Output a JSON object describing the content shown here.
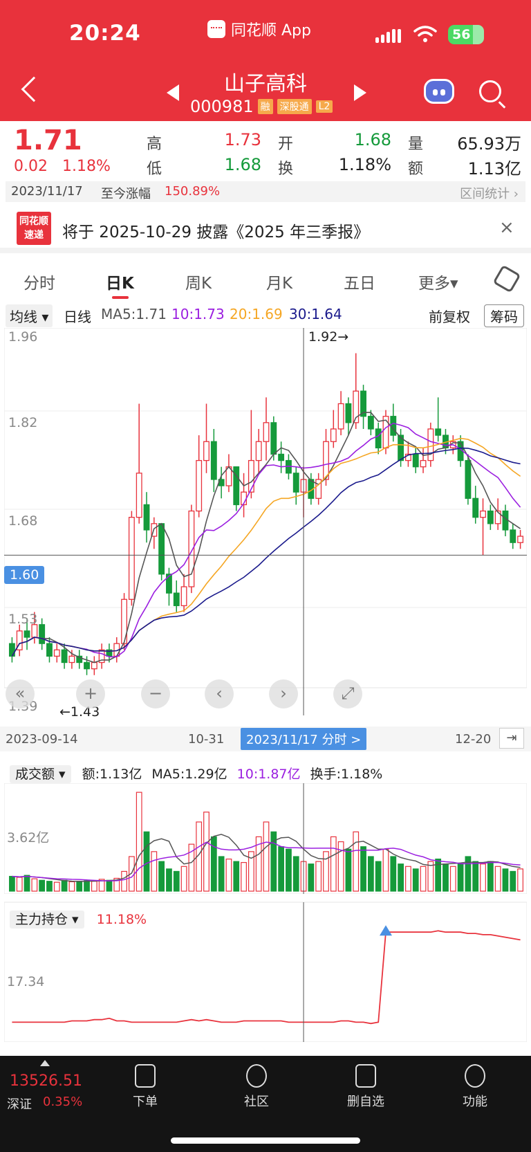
{
  "status_bar": {
    "time": "20:24",
    "app_label": "同花顺 App",
    "battery": "56"
  },
  "header": {
    "stock_name": "山子高科",
    "stock_code": "000981",
    "tags": [
      "融",
      "深股通",
      "L2"
    ]
  },
  "quote": {
    "price": "1.71",
    "change": "0.02",
    "change_pct": "1.18%",
    "high_label": "高",
    "high": "1.73",
    "low_label": "低",
    "low": "1.68",
    "open_label": "开",
    "open": "1.68",
    "turnover_label": "换",
    "turnover": "1.18%",
    "volume_label": "量",
    "volume": "65.93万",
    "amount_label": "额",
    "amount": "1.13亿",
    "colors": {
      "up": "#e8323c",
      "down": "#159a3b"
    }
  },
  "date_bar": {
    "date": "2023/11/17",
    "label": "至今涨幅",
    "value": "150.89%",
    "stat": "区间统计"
  },
  "notice": {
    "logo_line1": "同花顺",
    "logo_line2": "速递",
    "text": "将于 2025-10-29 披露《2025 年三季报》",
    "close": "×"
  },
  "tabs": [
    "分时",
    "日K",
    "周K",
    "月K",
    "五日",
    "更多▾"
  ],
  "ma_bar": {
    "selector": "均线",
    "period": "日线",
    "ma5": "MA5:1.71",
    "ma10": "10:1.73",
    "ma20": "20:1.69",
    "ma30": "30:1.64",
    "fq": "前复权",
    "chips": "筹码"
  },
  "kline": {
    "y_labels": [
      "1.96",
      "1.82",
      "1.68",
      "1.53",
      "1.39"
    ],
    "cursor_price": "1.60",
    "high_mark": "1.92→",
    "low_mark": "←1.43",
    "date_start": "2023-09-14",
    "date_mid": "10-31",
    "date_pill": "2023/11/17 分时 >",
    "date_end": "12-20"
  },
  "volume_panel": {
    "selector": "成交额",
    "amt": "额:1.13亿",
    "ma5": "MA5:1.29亿",
    "ma10": "10:1.87亿",
    "turnover": "换手:1.18%",
    "y_label": "3.62亿"
  },
  "holding_panel": {
    "selector": "主力持仓",
    "value": "11.18%",
    "y_label": "17.34"
  },
  "bottom_nav": {
    "index_value": "13526.51",
    "index_name": "深证",
    "index_pct": "0.35%",
    "items": [
      "下单",
      "社区",
      "删自选",
      "功能"
    ]
  },
  "chart_data": {
    "type": "candlestick",
    "ylim": [
      1.39,
      1.96
    ],
    "candles": [
      [
        1.46,
        1.44,
        1.47,
        1.43
      ],
      [
        1.45,
        1.48,
        1.49,
        1.44
      ],
      [
        1.48,
        1.47,
        1.5,
        1.45
      ],
      [
        1.47,
        1.49,
        1.51,
        1.46
      ],
      [
        1.49,
        1.46,
        1.5,
        1.45
      ],
      [
        1.46,
        1.44,
        1.47,
        1.43
      ],
      [
        1.44,
        1.45,
        1.46,
        1.43
      ],
      [
        1.45,
        1.43,
        1.46,
        1.42
      ],
      [
        1.43,
        1.44,
        1.45,
        1.42
      ],
      [
        1.44,
        1.43,
        1.45,
        1.42
      ],
      [
        1.43,
        1.42,
        1.44,
        1.41
      ],
      [
        1.42,
        1.43,
        1.44,
        1.41
      ],
      [
        1.43,
        1.45,
        1.46,
        1.42
      ],
      [
        1.45,
        1.44,
        1.46,
        1.43
      ],
      [
        1.44,
        1.46,
        1.47,
        1.43
      ],
      [
        1.46,
        1.53,
        1.54,
        1.45
      ],
      [
        1.53,
        1.66,
        1.67,
        1.52
      ],
      [
        1.66,
        1.73,
        1.84,
        1.65
      ],
      [
        1.68,
        1.64,
        1.7,
        1.62
      ],
      [
        1.63,
        1.65,
        1.66,
        1.61
      ],
      [
        1.65,
        1.57,
        1.65,
        1.56
      ],
      [
        1.57,
        1.54,
        1.58,
        1.52
      ],
      [
        1.54,
        1.52,
        1.56,
        1.51
      ],
      [
        1.52,
        1.55,
        1.57,
        1.51
      ],
      [
        1.55,
        1.67,
        1.68,
        1.54
      ],
      [
        1.67,
        1.75,
        1.79,
        1.66
      ],
      [
        1.75,
        1.78,
        1.84,
        1.73
      ],
      [
        1.78,
        1.72,
        1.8,
        1.7
      ],
      [
        1.72,
        1.71,
        1.74,
        1.69
      ],
      [
        1.71,
        1.74,
        1.76,
        1.7
      ],
      [
        1.74,
        1.68,
        1.74,
        1.67
      ],
      [
        1.68,
        1.7,
        1.73,
        1.66
      ],
      [
        1.7,
        1.75,
        1.83,
        1.69
      ],
      [
        1.75,
        1.78,
        1.8,
        1.73
      ],
      [
        1.78,
        1.81,
        1.85,
        1.75
      ],
      [
        1.81,
        1.76,
        1.82,
        1.75
      ],
      [
        1.76,
        1.75,
        1.78,
        1.73
      ],
      [
        1.75,
        1.73,
        1.76,
        1.72
      ],
      [
        1.73,
        1.7,
        1.74,
        1.68
      ],
      [
        1.7,
        1.72,
        1.74,
        1.66
      ],
      [
        1.72,
        1.69,
        1.73,
        1.68
      ],
      [
        1.69,
        1.72,
        1.73,
        1.68
      ],
      [
        1.72,
        1.78,
        1.8,
        1.71
      ],
      [
        1.78,
        1.8,
        1.83,
        1.77
      ],
      [
        1.8,
        1.84,
        1.86,
        1.79
      ],
      [
        1.84,
        1.81,
        1.85,
        1.79
      ],
      [
        1.81,
        1.86,
        1.92,
        1.8
      ],
      [
        1.86,
        1.82,
        1.87,
        1.8
      ],
      [
        1.82,
        1.8,
        1.83,
        1.79
      ],
      [
        1.8,
        1.77,
        1.81,
        1.76
      ],
      [
        1.77,
        1.82,
        1.83,
        1.76
      ],
      [
        1.82,
        1.79,
        1.84,
        1.78
      ],
      [
        1.79,
        1.75,
        1.8,
        1.74
      ],
      [
        1.75,
        1.76,
        1.78,
        1.74
      ],
      [
        1.76,
        1.74,
        1.77,
        1.73
      ],
      [
        1.74,
        1.75,
        1.77,
        1.73
      ],
      [
        1.75,
        1.8,
        1.81,
        1.74
      ],
      [
        1.8,
        1.79,
        1.85,
        1.78
      ],
      [
        1.79,
        1.77,
        1.8,
        1.76
      ],
      [
        1.77,
        1.78,
        1.79,
        1.76
      ],
      [
        1.78,
        1.75,
        1.79,
        1.74
      ],
      [
        1.75,
        1.69,
        1.76,
        1.68
      ],
      [
        1.69,
        1.66,
        1.71,
        1.65
      ],
      [
        1.66,
        1.67,
        1.69,
        1.6
      ],
      [
        1.67,
        1.65,
        1.68,
        1.64
      ],
      [
        1.65,
        1.67,
        1.69,
        1.64
      ],
      [
        1.67,
        1.64,
        1.68,
        1.63
      ],
      [
        1.64,
        1.62,
        1.65,
        1.61
      ],
      [
        1.62,
        1.63,
        1.64,
        1.61
      ]
    ],
    "ma5_color": "#555555",
    "ma10_color": "#9b1fe0",
    "ma20_color": "#f5a623",
    "ma30_color": "#1a1a8c",
    "volume": [
      30,
      28,
      32,
      25,
      22,
      20,
      18,
      22,
      19,
      20,
      21,
      20,
      24,
      22,
      26,
      40,
      70,
      200,
      120,
      80,
      60,
      45,
      40,
      50,
      95,
      140,
      160,
      110,
      70,
      65,
      60,
      58,
      80,
      110,
      140,
      120,
      90,
      85,
      70,
      60,
      55,
      60,
      80,
      110,
      100,
      85,
      120,
      90,
      70,
      60,
      85,
      70,
      55,
      50,
      45,
      50,
      60,
      65,
      55,
      50,
      55,
      70,
      60,
      55,
      60,
      50,
      45,
      40,
      45
    ],
    "holding": [
      10,
      10,
      10,
      10,
      10,
      10,
      10,
      10,
      11,
      11,
      11,
      12,
      12,
      13,
      11,
      11,
      10,
      10,
      10,
      10,
      10,
      10,
      10,
      11,
      12,
      11,
      12,
      11,
      10,
      10,
      10,
      11,
      11,
      11,
      11,
      11,
      11,
      10,
      10,
      10,
      10,
      10,
      10,
      10,
      11,
      11,
      10,
      10,
      9,
      10,
      80,
      80,
      80,
      80,
      80,
      80,
      80,
      81,
      80,
      80,
      80,
      79,
      79,
      78,
      78,
      77,
      76,
      75,
      74
    ]
  }
}
